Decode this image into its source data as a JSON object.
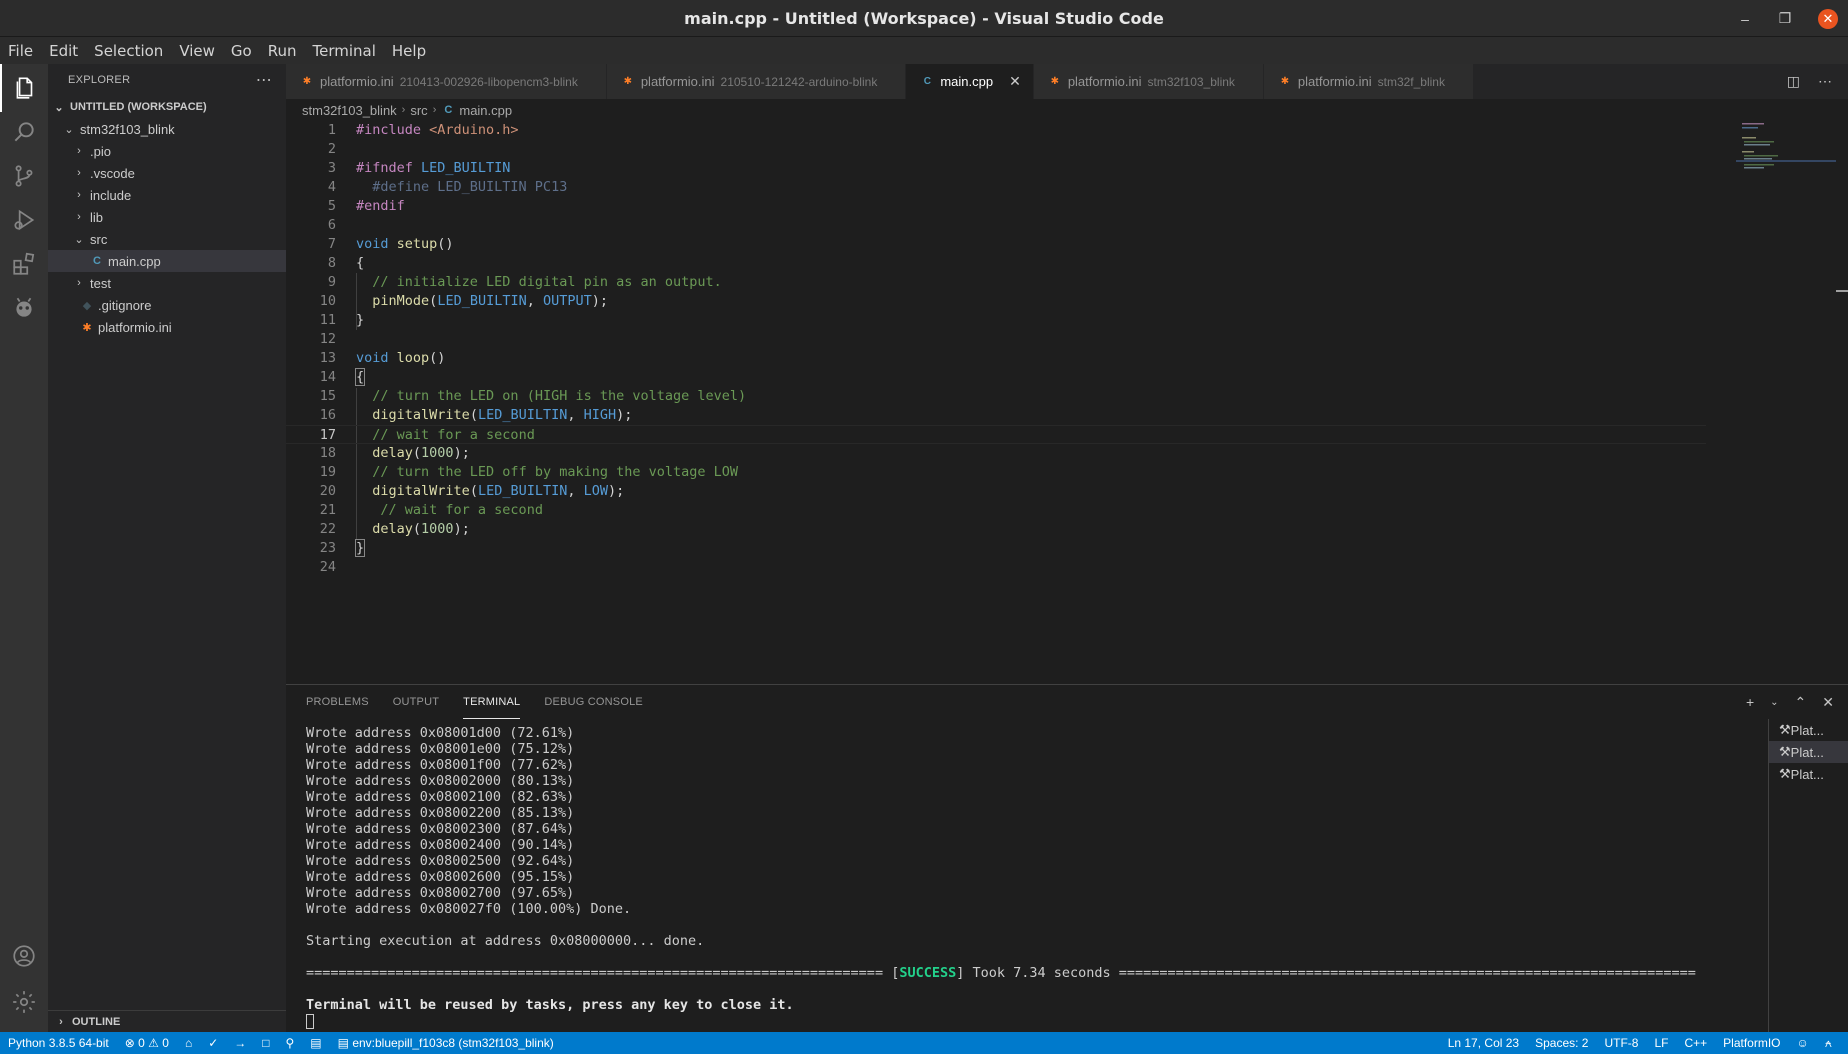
{
  "window": {
    "title": "main.cpp - Untitled (Workspace) - Visual Studio Code"
  },
  "menu": [
    "File",
    "Edit",
    "Selection",
    "View",
    "Go",
    "Run",
    "Terminal",
    "Help"
  ],
  "sidebar": {
    "header": "EXPLORER",
    "more": "⋯",
    "workspace": "UNTITLED (WORKSPACE)",
    "tree": [
      {
        "label": "stm32f103_blink",
        "indent": 0,
        "chevron": "⌵",
        "kind": "folder-open"
      },
      {
        "label": ".pio",
        "indent": 1,
        "chevron": "›",
        "kind": "folder"
      },
      {
        "label": ".vscode",
        "indent": 1,
        "chevron": "›",
        "kind": "folder"
      },
      {
        "label": "include",
        "indent": 1,
        "chevron": "›",
        "kind": "folder"
      },
      {
        "label": "lib",
        "indent": 1,
        "chevron": "›",
        "kind": "folder"
      },
      {
        "label": "src",
        "indent": 1,
        "chevron": "⌵",
        "kind": "folder-open"
      },
      {
        "label": "main.cpp",
        "indent": 2,
        "chevron": "",
        "kind": "cpp",
        "selected": true
      },
      {
        "label": "test",
        "indent": 1,
        "chevron": "›",
        "kind": "folder"
      },
      {
        "label": ".gitignore",
        "indent": 1,
        "chevron": "",
        "kind": "git"
      },
      {
        "label": "platformio.ini",
        "indent": 1,
        "chevron": "",
        "kind": "pio"
      }
    ],
    "outline": "OUTLINE"
  },
  "tabs": [
    {
      "label": "platformio.ini",
      "desc": "210413-002926-libopencm3-blink",
      "icon": "pio",
      "active": false
    },
    {
      "label": "platformio.ini",
      "desc": "210510-121242-arduino-blink",
      "icon": "pio",
      "active": false
    },
    {
      "label": "main.cpp",
      "desc": "",
      "icon": "cpp",
      "active": true
    },
    {
      "label": "platformio.ini",
      "desc": "stm32f103_blink",
      "icon": "pio",
      "active": false
    },
    {
      "label": "platformio.ini",
      "desc": "stm32f_blink",
      "icon": "pio",
      "active": false
    }
  ],
  "breadcrumb": [
    "stm32f103_blink",
    "src",
    "main.cpp"
  ],
  "editor": {
    "current_line": 17,
    "lines": [
      {
        "n": "1",
        "tokens": [
          [
            "k-pre",
            "#include "
          ],
          [
            "k-str",
            "<Arduino.h>"
          ]
        ]
      },
      {
        "n": "2",
        "tokens": []
      },
      {
        "n": "3",
        "tokens": [
          [
            "k-pre",
            "#ifndef "
          ],
          [
            "k-mac",
            "LED_BUILTIN"
          ]
        ]
      },
      {
        "n": "4",
        "tokens": [
          [
            "k-dim",
            "  #define LED_BUILTIN PC13"
          ]
        ]
      },
      {
        "n": "5",
        "tokens": [
          [
            "k-pre",
            "#endif"
          ]
        ]
      },
      {
        "n": "6",
        "tokens": []
      },
      {
        "n": "7",
        "tokens": [
          [
            "k-type",
            "void "
          ],
          [
            "k-fn",
            "setup"
          ],
          [
            "k-plain",
            "()"
          ]
        ]
      },
      {
        "n": "8",
        "tokens": [
          [
            "k-plain",
            "{"
          ]
        ]
      },
      {
        "n": "9",
        "tokens": [
          [
            "k-plain",
            "  "
          ],
          [
            "k-cm",
            "// initialize LED digital pin as an output."
          ]
        ]
      },
      {
        "n": "10",
        "tokens": [
          [
            "k-plain",
            "  "
          ],
          [
            "k-fn",
            "pinMode"
          ],
          [
            "k-plain",
            "("
          ],
          [
            "k-mac",
            "LED_BUILTIN"
          ],
          [
            "k-plain",
            ", "
          ],
          [
            "k-mac",
            "OUTPUT"
          ],
          [
            "k-plain",
            ");"
          ]
        ]
      },
      {
        "n": "11",
        "tokens": [
          [
            "k-plain",
            "}"
          ]
        ]
      },
      {
        "n": "12",
        "tokens": []
      },
      {
        "n": "13",
        "tokens": [
          [
            "k-type",
            "void "
          ],
          [
            "k-fn",
            "loop"
          ],
          [
            "k-plain",
            "()"
          ]
        ]
      },
      {
        "n": "14",
        "tokens": [
          [
            "k-plain k-bracket",
            "{"
          ]
        ]
      },
      {
        "n": "15",
        "tokens": [
          [
            "k-plain",
            "  "
          ],
          [
            "k-cm",
            "// turn the LED on (HIGH is the voltage level)"
          ]
        ]
      },
      {
        "n": "16",
        "tokens": [
          [
            "k-plain",
            "  "
          ],
          [
            "k-fn",
            "digitalWrite"
          ],
          [
            "k-plain",
            "("
          ],
          [
            "k-mac",
            "LED_BUILTIN"
          ],
          [
            "k-plain",
            ", "
          ],
          [
            "k-mac",
            "HIGH"
          ],
          [
            "k-plain",
            ");"
          ]
        ]
      },
      {
        "n": "17",
        "tokens": [
          [
            "k-plain",
            "  "
          ],
          [
            "k-cm",
            "// wait for a second"
          ]
        ]
      },
      {
        "n": "18",
        "tokens": [
          [
            "k-plain",
            "  "
          ],
          [
            "k-fn",
            "delay"
          ],
          [
            "k-plain",
            "("
          ],
          [
            "k-num",
            "1000"
          ],
          [
            "k-plain",
            ");"
          ]
        ]
      },
      {
        "n": "19",
        "tokens": [
          [
            "k-plain",
            "  "
          ],
          [
            "k-cm",
            "// turn the LED off by making the voltage LOW"
          ]
        ]
      },
      {
        "n": "20",
        "tokens": [
          [
            "k-plain",
            "  "
          ],
          [
            "k-fn",
            "digitalWrite"
          ],
          [
            "k-plain",
            "("
          ],
          [
            "k-mac",
            "LED_BUILTIN"
          ],
          [
            "k-plain",
            ", "
          ],
          [
            "k-mac",
            "LOW"
          ],
          [
            "k-plain",
            ");"
          ]
        ]
      },
      {
        "n": "21",
        "tokens": [
          [
            "k-plain",
            "   "
          ],
          [
            "k-cm",
            "// wait for a second"
          ]
        ]
      },
      {
        "n": "22",
        "tokens": [
          [
            "k-plain",
            "  "
          ],
          [
            "k-fn",
            "delay"
          ],
          [
            "k-plain",
            "("
          ],
          [
            "k-num",
            "1000"
          ],
          [
            "k-plain",
            ");"
          ]
        ]
      },
      {
        "n": "23",
        "tokens": [
          [
            "k-plain k-bracket",
            "}"
          ]
        ]
      },
      {
        "n": "24",
        "tokens": []
      }
    ]
  },
  "panel": {
    "tabs": [
      {
        "label": "PROBLEMS",
        "active": false
      },
      {
        "label": "OUTPUT",
        "active": false
      },
      {
        "label": "TERMINAL",
        "active": true
      },
      {
        "label": "DEBUG CONSOLE",
        "active": false
      }
    ],
    "terminal_lines": [
      "Wrote address 0x08001d00 (72.61%)",
      "Wrote address 0x08001e00 (75.12%)",
      "Wrote address 0x08001f00 (77.62%)",
      "Wrote address 0x08002000 (80.13%)",
      "Wrote address 0x08002100 (82.63%)",
      "Wrote address 0x08002200 (85.13%)",
      "Wrote address 0x08002300 (87.64%)",
      "Wrote address 0x08002400 (90.14%)",
      "Wrote address 0x08002500 (92.64%)",
      "Wrote address 0x08002600 (95.15%)",
      "Wrote address 0x08002700 (97.65%)",
      "Wrote address 0x080027f0 (100.00%) Done.",
      "",
      "Starting execution at address 0x08000000... done.",
      ""
    ],
    "success_line": {
      "left": "======================================================================= [",
      "word": "SUCCESS",
      "right": "] Took 7.34 seconds ======================================================================="
    },
    "reuse_line": "Terminal will be reused by tasks, press any key to close it.",
    "terminal_list": [
      {
        "label": "Plat...",
        "selected": false
      },
      {
        "label": "Plat...",
        "selected": true
      },
      {
        "label": "Plat...",
        "selected": false
      }
    ]
  },
  "status": {
    "python": "Python 3.8.5 64-bit",
    "errors": "0",
    "warnings": "0",
    "env": "env:bluepill_f103c8 (stm32f103_blink)",
    "position": "Ln 17, Col 23",
    "spaces": "Spaces: 2",
    "encoding": "UTF-8",
    "eol": "LF",
    "language": "C++",
    "platformio": "PlatformIO"
  },
  "colors": {
    "accent": "#007acc",
    "pio_orange": "#ff7f27",
    "cpp_blue": "#519aba",
    "success": "#23d18b"
  }
}
